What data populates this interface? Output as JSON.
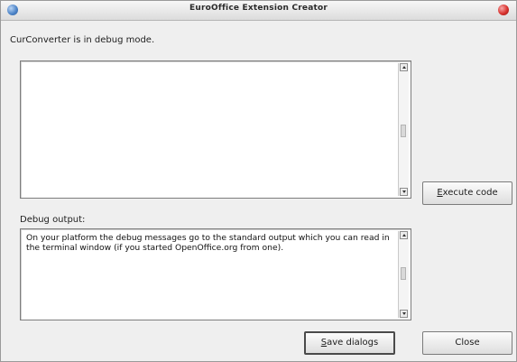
{
  "window": {
    "title": "EuroOffice Extension Creator"
  },
  "status_message": "CurConverter is in debug mode.",
  "code_editor": {
    "value": ""
  },
  "buttons": {
    "execute_first": "E",
    "execute_rest": "xecute code",
    "save_first": "S",
    "save_rest": "ave dialogs",
    "close": "Close"
  },
  "debug": {
    "label": "Debug output:",
    "text": "On your platform the debug messages go to the standard output which you can read in the terminal window (if you started OpenOffice.org from one)."
  },
  "icons": {
    "left_ball": "blue-orb-icon",
    "right_ball": "red-close-orb-icon"
  },
  "colors": {
    "close_orb": "#d8322e",
    "menu_orb": "#4f86c9"
  }
}
